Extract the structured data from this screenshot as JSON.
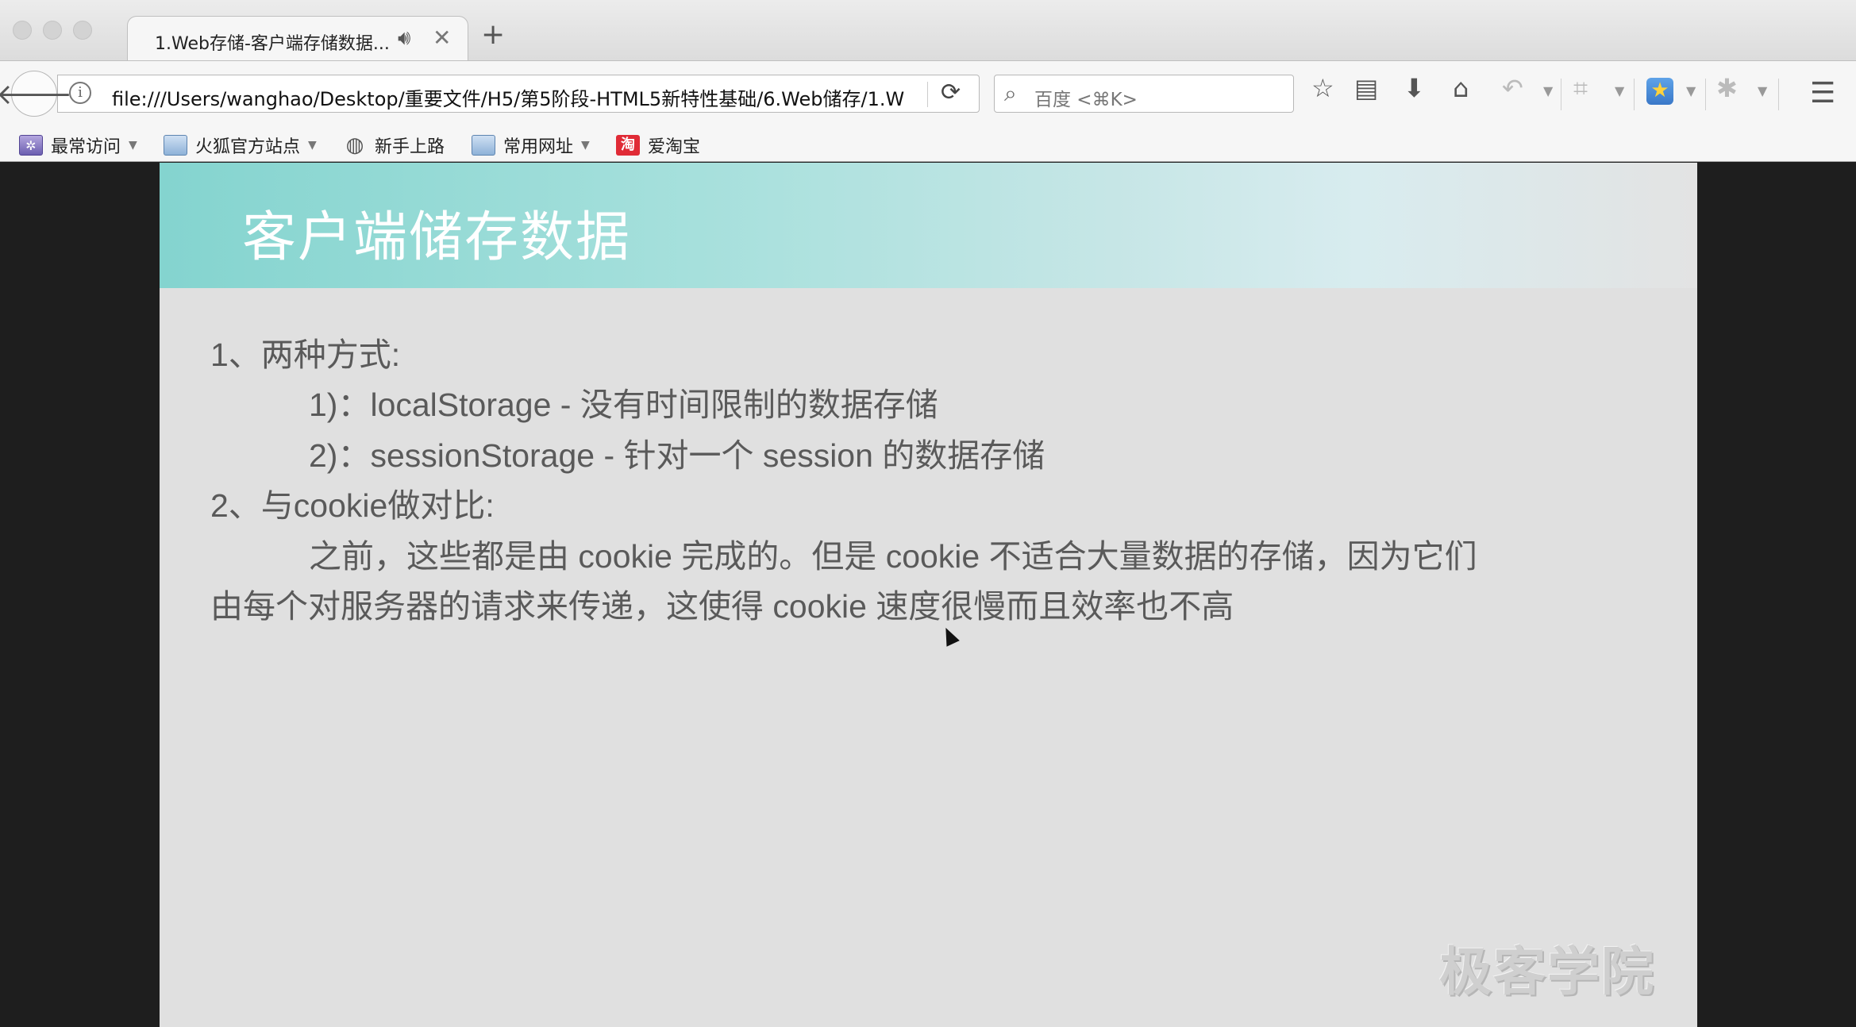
{
  "browser": {
    "tab": {
      "title": "1.Web存储-客户端存储数据...",
      "audio_icon": "speaker-icon",
      "close_glyph": "✕"
    },
    "new_tab_glyph": "+",
    "url": "file:///Users/wanghao/Desktop/重要文件/H5/第5阶段-HTML5新特性基础/6.Web储存/1.W",
    "search_placeholder": "百度 <⌘K>",
    "bookmarks": [
      {
        "label": "最常访问",
        "icon": "most-visited-icon",
        "dropdown": true
      },
      {
        "label": "火狐官方站点",
        "icon": "folder-icon",
        "dropdown": true
      },
      {
        "label": "新手上路",
        "icon": "globe-icon",
        "dropdown": false
      },
      {
        "label": "常用网址",
        "icon": "folder-icon",
        "dropdown": true
      },
      {
        "label": "爱淘宝",
        "icon": "taobao-icon",
        "icon_text": "淘",
        "dropdown": false
      }
    ]
  },
  "slide": {
    "title": "客户端储存数据",
    "lines": [
      "1、两种方式:",
      "1)：localStorage - 没有时间限制的数据存储",
      "2)：sessionStorage - 针对一个 session 的数据存储",
      "2、与cookie做对比:",
      "之前，这些都是由 cookie 完成的。但是 cookie 不适合大量数据的存储，因为它们",
      "由每个对服务器的请求来传递，这使得 cookie 速度很慢而且效率也不高"
    ],
    "watermark": "极客学院"
  },
  "colors": {
    "header_start": "#84d4cf",
    "slide_bg": "#e0e0e0",
    "page_bg": "#1e1e1e",
    "text": "#5a5a5a"
  }
}
